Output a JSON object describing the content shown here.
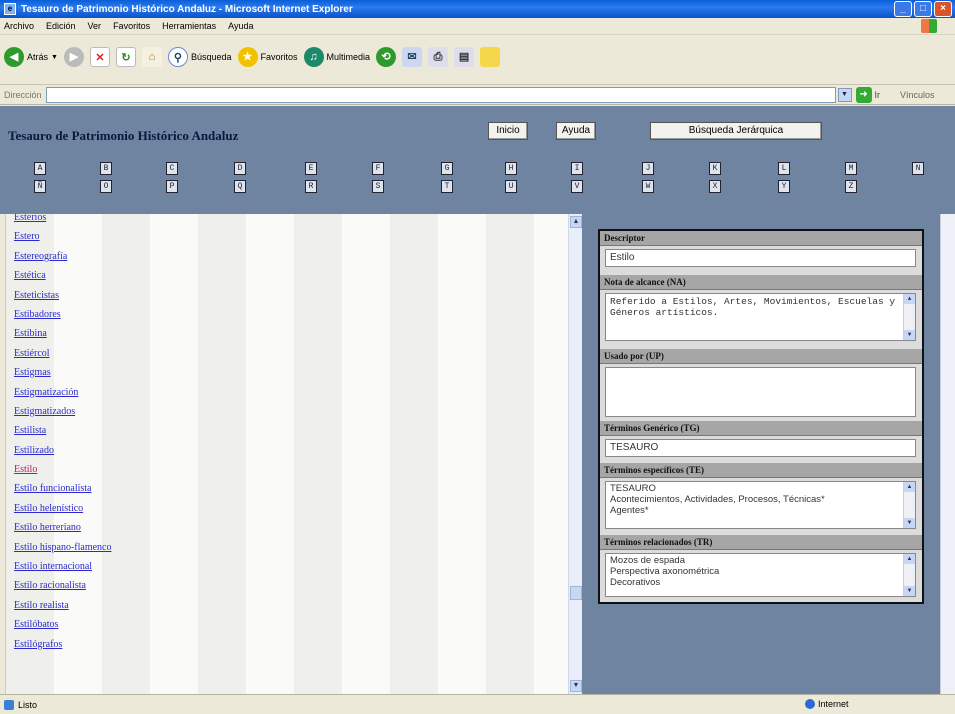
{
  "window": {
    "title": "Tesauro de Patrimonio Histórico Andaluz - Microsoft Internet Explorer",
    "minimize": "_",
    "maximize": "□",
    "close": "×"
  },
  "menu": [
    "Archivo",
    "Edición",
    "Ver",
    "Favoritos",
    "Herramientas",
    "Ayuda"
  ],
  "toolbar": {
    "back": "Atrás",
    "search": "Búsqueda",
    "favorites": "Favoritos",
    "multimedia": "Multimedia"
  },
  "address": {
    "label": "Dirección",
    "value": "",
    "go": "Ir",
    "links": "Vínculos"
  },
  "header": {
    "title": "Tesauro de Patrimonio Histórico Andaluz",
    "buttons": [
      "Inicio",
      "Ayuda",
      "Búsqueda Jerárquica"
    ]
  },
  "alphabet": {
    "row1": [
      "A",
      "B",
      "C",
      "D",
      "E",
      "F",
      "G",
      "H",
      "I",
      "J",
      "K",
      "L",
      "M",
      "N"
    ],
    "row2": [
      "Ñ",
      "O",
      "P",
      "Q",
      "R",
      "S",
      "T",
      "U",
      "V",
      "W",
      "X",
      "Y",
      "Z"
    ]
  },
  "terms": [
    "Esterios",
    "Estero",
    "Estereografía",
    "Estética",
    "Esteticistas",
    "Estibadores",
    "Estibina",
    "Estiércol",
    "Estigmas",
    "Estigmatización",
    "Estigmatizados",
    "Estilista",
    "Estilizado",
    "Estilo",
    "Estilo funcionalista",
    "Estilo helenístico",
    "Estilo herreriano",
    "Estilo hispano-flamenco",
    "Estilo internacional",
    "Estilo racionalista",
    "Estilo realista",
    "Estilóbatos",
    "Estilógrafos"
  ],
  "detail": {
    "descriptor_label": "Descriptor",
    "descriptor": "Estilo",
    "scope_label": "Nota de alcance (NA)",
    "scope_note": "Referido a Estilos, Artes, Movimientos, Escuelas y Géneros artísticos.",
    "used_for_label": "Usado por (UP)",
    "used_for": "",
    "generic_label": "Términos Genérico (TG)",
    "generic": "TESAURO",
    "specific_label": "Términos específicos (TE)",
    "specific": [
      "TESAURO",
      "Acontecimientos, Actividades, Procesos, Técnicas*",
      "Agentes*"
    ],
    "related_label": "Términos relacionados (TR)",
    "related": [
      "Mozos de espada",
      "Perspectiva axonométrica",
      "Decorativos"
    ]
  },
  "status": {
    "text": "Listo",
    "zone": "Internet"
  }
}
